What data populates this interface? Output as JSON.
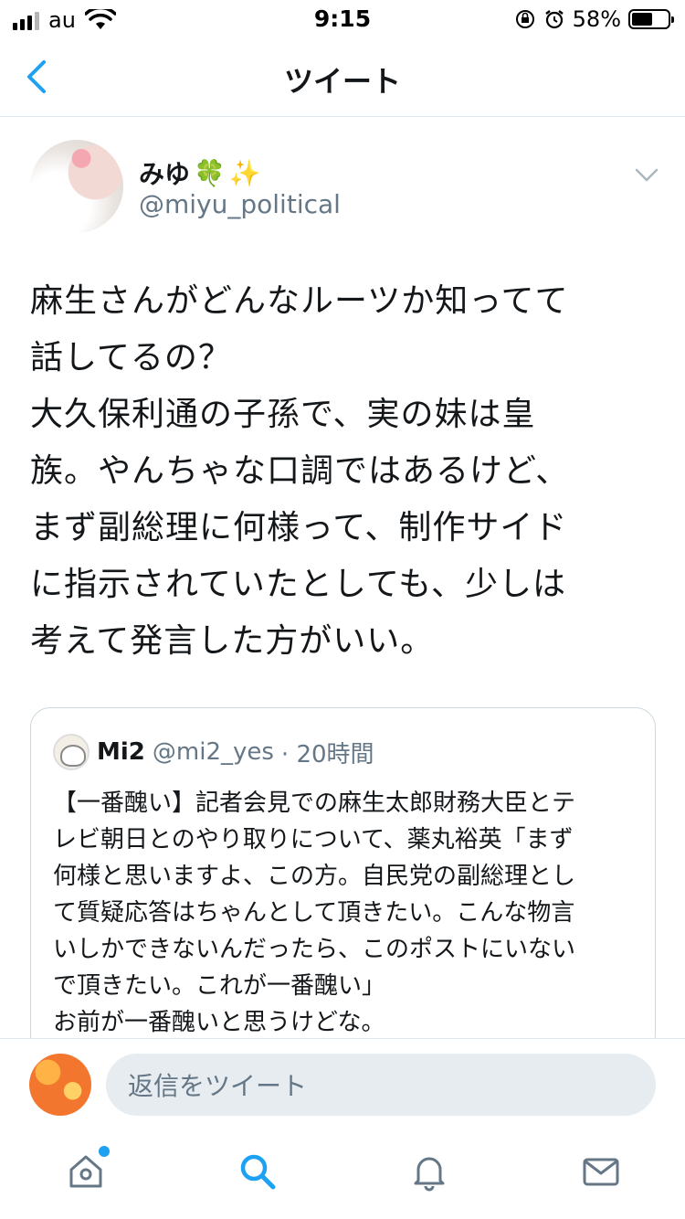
{
  "status_bar": {
    "carrier": "au",
    "time": "9:15",
    "battery_percent": "58%",
    "battery_level": 0.58
  },
  "header": {
    "title": "ツイート",
    "back_icon": "chevron-left-icon"
  },
  "tweet": {
    "display_name": "みゆ",
    "handle": "@miyu_political",
    "text": "麻生さんがどんなルーツか知ってて\n話してるの？\n大久保利通の子孫で、実の妹は皇\n族。やんちゃな口調ではあるけど、\nまず副総理に何様って、制作サイド\nに指示されていたとしても、少しは\n考えて発言した方がいい。"
  },
  "quoted_tweet": {
    "display_name": "Mi2",
    "handle": "@mi2_yes",
    "timestamp": "· 20時間",
    "text": "【一番醜い】記者会見での麻生太郎財務大臣とテ\nレビ朝日とのやり取りについて、薬丸裕英「まず\n何様と思いますよ、この方。自民党の副総理とし\nて質疑応答はちゃんとして頂きたい。こんな物言\nいしかできないんだったら、このポストにいない\nで頂きたい。これが一番醜い」\nお前が一番醜いと思うけどな。"
  },
  "reply": {
    "placeholder": "返信をツイート"
  },
  "tab_bar": {
    "items": [
      {
        "name": "home",
        "icon": "home-icon",
        "has_badge": true
      },
      {
        "name": "search",
        "icon": "search-icon",
        "active": true
      },
      {
        "name": "notifications",
        "icon": "bell-icon"
      },
      {
        "name": "messages",
        "icon": "mail-icon"
      }
    ]
  },
  "colors": {
    "accent": "#1da1f2",
    "text": "#14171a",
    "secondary": "#657786",
    "border": "#e1e8ed"
  }
}
